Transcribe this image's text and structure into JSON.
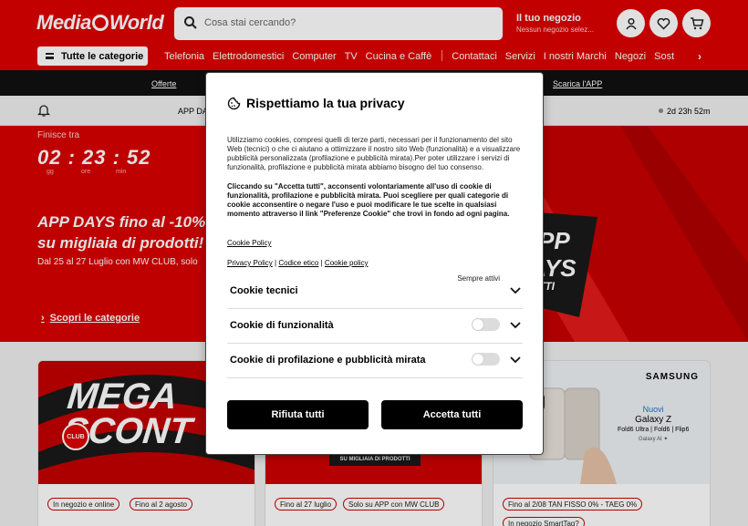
{
  "header": {
    "logo_left": "Media",
    "logo_right": "World",
    "search_placeholder": "Cosa stai cercando?",
    "store_title": "Il tuo negozio",
    "store_sub": "Nessun negozio selez...",
    "categories_label": "Tutte le categorie",
    "nav_items": [
      "Telefonia",
      "Elettrodomestici",
      "Computer",
      "TV",
      "Cucina e Caffè"
    ],
    "nav_items2": [
      "Contattaci",
      "Servizi",
      "I nostri Marchi",
      "Negozi",
      "Sost"
    ],
    "colors": {
      "brand_red": "#df0000",
      "black": "#000000"
    }
  },
  "blackbar": {
    "offers": "Offerte",
    "download_app": "Scarica l'APP"
  },
  "greybar": {
    "app_text": "APP DA",
    "countdown": "2d 23h 52m"
  },
  "hero": {
    "ends_in": "Finisce tra",
    "timer": "02 : 23 : 52",
    "units": [
      "gg",
      "ore",
      "min"
    ],
    "headline_1": "APP DAYS fino al -10%",
    "headline_2": "su migliaia di prodotti!",
    "subline": "Dal 25 al 27 Luglio con MW CLUB, solo",
    "bg_text_1": "PP",
    "bg_text_2": "AYS",
    "bg_text_3": "TTI",
    "link": "Scopri le categorie"
  },
  "cards": [
    {
      "big_1": "MEGA",
      "big_2": "SCONT",
      "small": "EI",
      "club": "CLUB",
      "chips": [
        "In negozio e online",
        "Fino al 2 agosto"
      ]
    },
    {
      "strip": "SU MIGLIAIA DI PRODOTTI",
      "chips": [
        "Fino al 27 luglio",
        "Solo su APP con MW CLUB"
      ]
    },
    {
      "brand": "SAMSUNG",
      "new": "Nuovi",
      "model": "Galaxy Z",
      "variants": "Fold6 Ultra | Fold6 | Flip6",
      "ai": "Galaxy AI ✦",
      "chips": [
        "Fino al 2/08 TAN FISSO 0% - TAEG 0%",
        "In negozio SmartTag?"
      ]
    }
  ],
  "modal": {
    "title": "Rispettiamo la tua privacy",
    "paragraph_1": "Utilizziamo cookies, compresi quelli di terze parti, necessari per il funzionamento del sito Web (tecnici) o che ci aiutano a ottimizzare il nostro sito Web (funzionalità) e a visualizzare pubblicità personalizzata (profilazione e pubblicità mirata).Per poter utilizzare i servizi di funzionalità, profilazione e pubblicità mirata abbiamo bisogno del tuo consenso.",
    "paragraph_2": "Cliccando su \"Accetta tutti\", acconsenti volontariamente all'uso di cookie di funzionalità, profilazione e pubblicità mirata. Puoi scegliere per quali categorie di cookie acconsentire o negare l'uso e puoi modificare le tue scelte in qualsiasi momento attraverso il link \"Preferenze Cookie\" che trovi in fondo ad ogni pagina.",
    "cookie_policy_link": "Cookie Policy",
    "privacy_policy": "Privacy Policy",
    "code_of_ethics": "Codice etico",
    "cookie_policy": "Cookie policy",
    "separator": "|",
    "rows": [
      {
        "label": "Cookie tecnici",
        "status": "Sempre attivi",
        "enabled": true
      },
      {
        "label": "Cookie di funzionalità",
        "enabled": false
      },
      {
        "label": "Cookie di profilazione e pubblicità mirata",
        "enabled": false
      }
    ],
    "reject_all": "Rifiuta tutti",
    "accept_all": "Accetta tutti"
  }
}
